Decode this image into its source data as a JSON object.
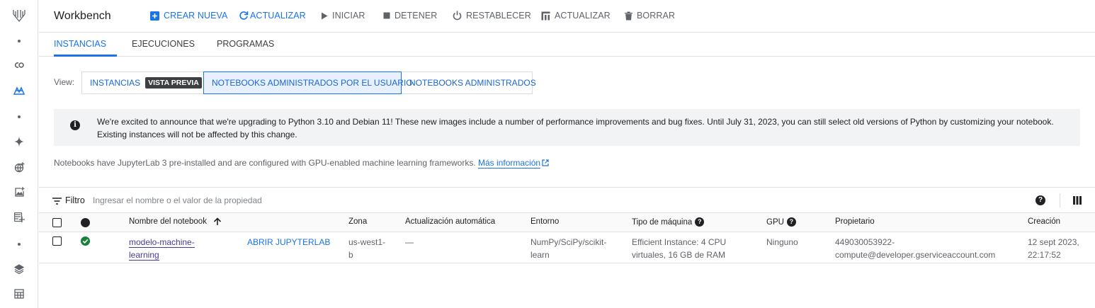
{
  "app": {
    "title": "Workbench"
  },
  "toolbar": {
    "create_label": "CREAR NUEVA",
    "refresh_label": "ACTUALIZAR",
    "start_label": "INICIAR",
    "stop_label": "DETENER",
    "reset_label": "RESTABLECER",
    "upgrade_label": "ACTUALIZAR",
    "delete_label": "BORRAR"
  },
  "tabs": [
    {
      "label": "INSTANCIAS",
      "active": true
    },
    {
      "label": "EJECUCIONES",
      "active": false
    },
    {
      "label": "PROGRAMAS",
      "active": false
    }
  ],
  "view": {
    "label": "View:",
    "options": [
      {
        "label": "INSTANCIAS",
        "badge": "VISTA PREVIA"
      },
      {
        "label": "NOTEBOOKS ADMINISTRADOS POR EL USUARIO",
        "selected": true
      },
      {
        "label": "NOTEBOOKS ADMINISTRADOS"
      }
    ]
  },
  "banner": {
    "text": "We're excited to announce that we're upgrading to Python 3.10 and Debian 11! These new images include a number of performance improvements and bug fixes. Until July 31, 2023, you can still select old versions of Python by customizing your notebook. Existing instances will not be affected by this change."
  },
  "notes": {
    "text": "Notebooks have JupyterLab 3 pre-installed and are configured with GPU-enabled machine learning frameworks.",
    "link": "Más información"
  },
  "filter": {
    "label": "Filtro",
    "placeholder": "Ingresar el nombre o el valor de la propiedad"
  },
  "table": {
    "headers": {
      "name": "Nombre del notebook",
      "zone": "Zona",
      "auto_update": "Actualización automática",
      "env": "Entorno",
      "machine": "Tipo de máquina",
      "gpu": "GPU",
      "owner": "Propietario",
      "created": "Creación"
    },
    "rows": [
      {
        "name_line1": "modelo-machine-",
        "name_line2": "learning",
        "action": "ABRIR JUPYTERLAB",
        "zone_line1": "us-west1-",
        "zone_line2": "b",
        "auto_update": "—",
        "env_line1": "NumPy/SciPy/scikit-",
        "env_line2": "learn",
        "machine_line1": "Efficient Instance: 4 CPU",
        "machine_line2": "virtuales, 16 GB de RAM",
        "gpu": "Ninguno",
        "owner_line1": "449030053922-",
        "owner_line2": "compute@developer.gserviceaccount.com",
        "created_line1": "12 sept 2023,",
        "created_line2": "22:17:52",
        "status": "running"
      }
    ]
  },
  "colors": {
    "accent": "#1a73e8",
    "status_ok": "#188038"
  }
}
